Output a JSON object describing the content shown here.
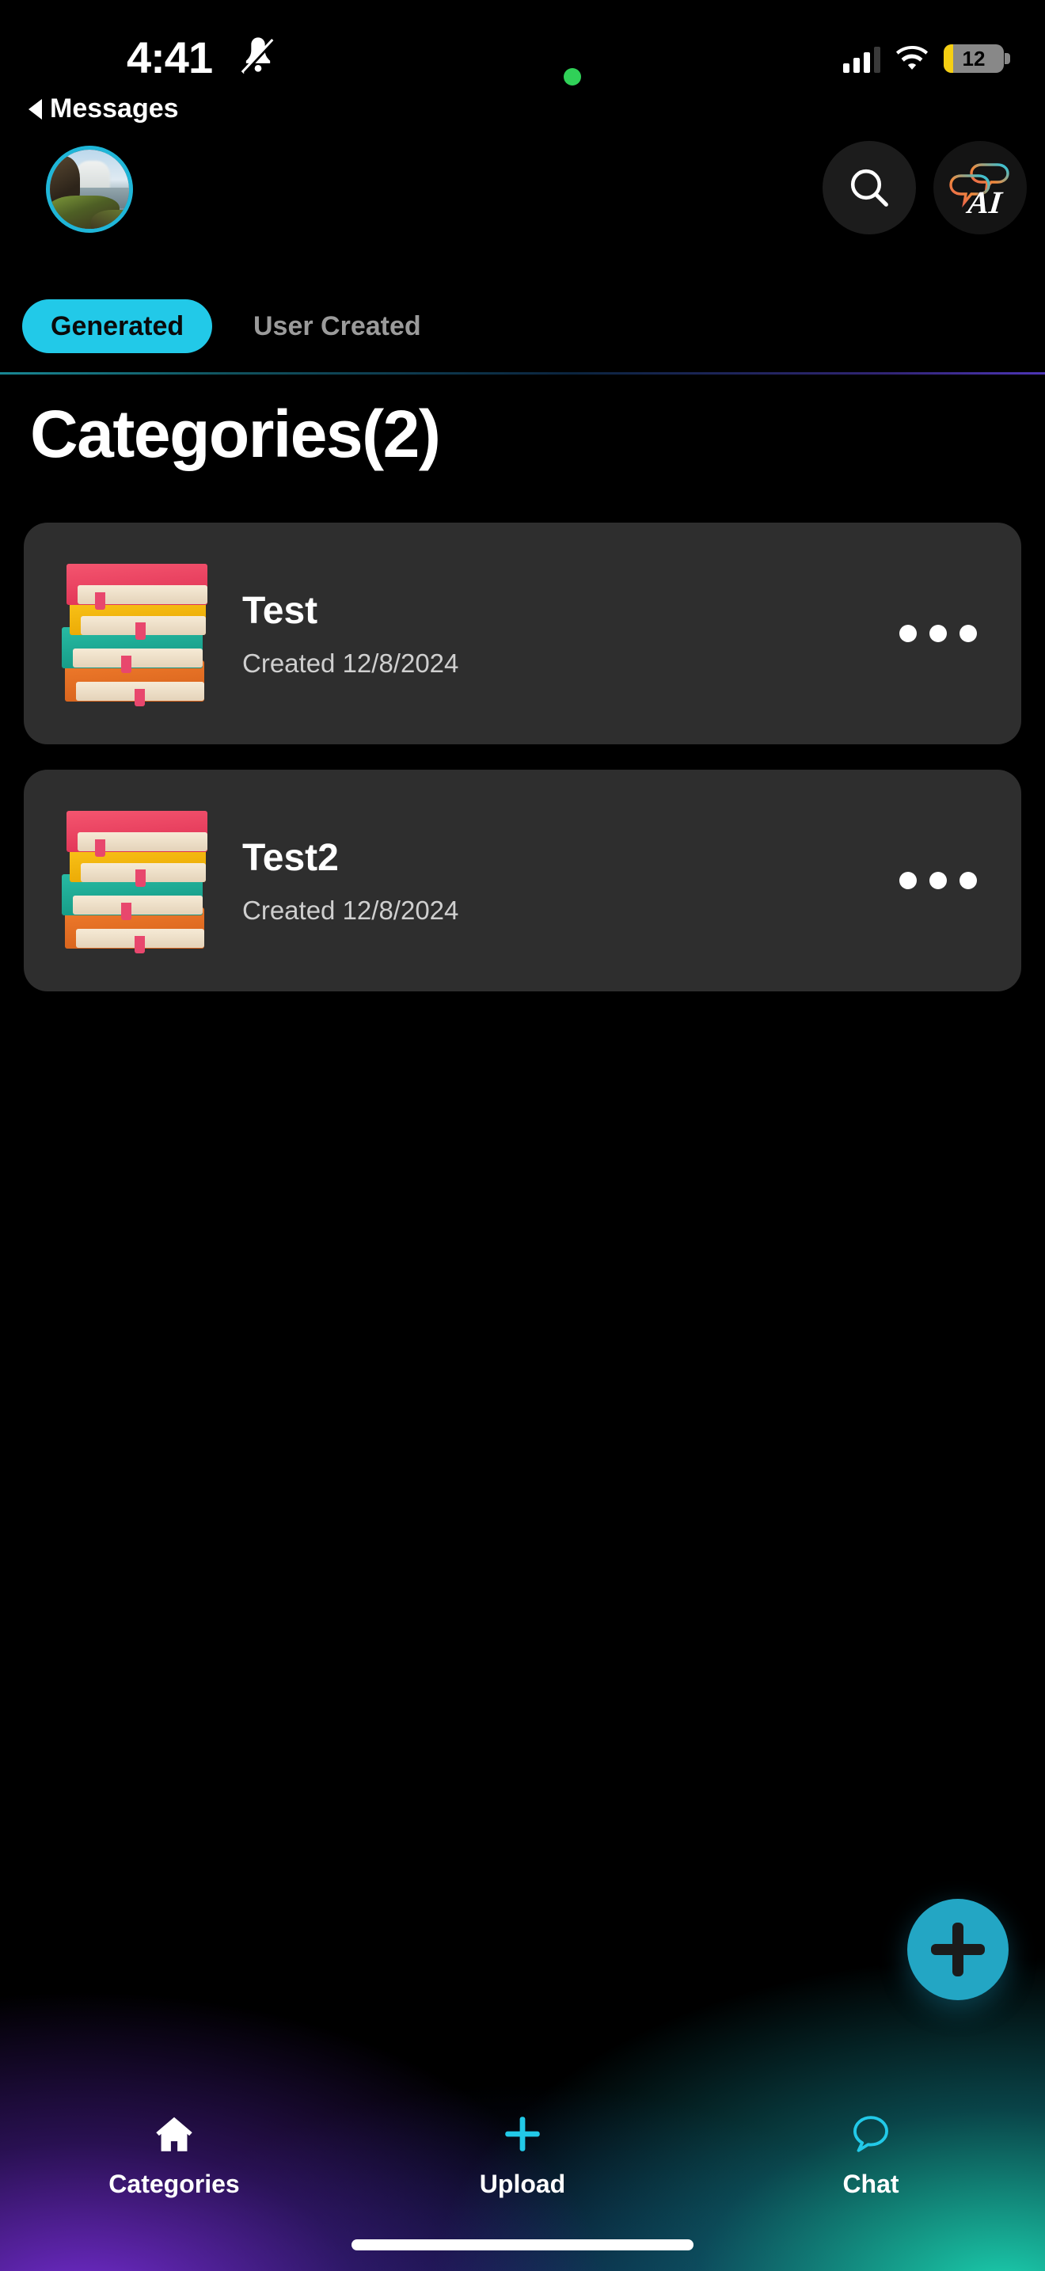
{
  "status_bar": {
    "time": "4:41",
    "silent_icon": "bell-slash-icon",
    "privacy_indicator": "green-dot",
    "cellular_icon": "signal-bars-icon",
    "wifi_icon": "wifi-icon",
    "battery_level": "12",
    "battery_color": "#f5cf12",
    "back_label": "Messages"
  },
  "topbar": {
    "avatar_name": "user-avatar",
    "search_icon": "search-icon",
    "ai_icon": "ai-chat-bubbles-icon",
    "ai_icon_text": "AI"
  },
  "tabs": {
    "active_index": 0,
    "items": [
      {
        "label": "Generated"
      },
      {
        "label": "User Created"
      }
    ],
    "active_bg": "#22c9e8",
    "active_fg": "#0a0a0a",
    "inactive_fg": "#9b9b9b"
  },
  "main": {
    "page_title": "Categories(2)",
    "count": 2,
    "cards": [
      {
        "title": "Test",
        "subtitle": "Created 12/8/2024",
        "icon": "book-stack-icon",
        "menu_icon": "more-options-icon"
      },
      {
        "title": "Test2",
        "subtitle": "Created 12/8/2024",
        "icon": "book-stack-icon",
        "menu_icon": "more-options-icon"
      }
    ]
  },
  "fab": {
    "icon": "plus-icon",
    "color": "#23a6c4"
  },
  "bottom_nav": {
    "items": [
      {
        "label": "Categories",
        "icon": "home-icon",
        "color": "#ffffff",
        "active": true
      },
      {
        "label": "Upload",
        "icon": "plus-icon",
        "color": "#22c9e8",
        "active": false
      },
      {
        "label": "Chat",
        "icon": "chat-bubble-icon",
        "color": "#22c9e8",
        "active": false
      }
    ]
  },
  "theme": {
    "background": "#000000",
    "card_bg": "#2e2e2e",
    "accent": "#22c9e8",
    "glow_left": "#7c30e0",
    "glow_right": "#1ee2be"
  }
}
